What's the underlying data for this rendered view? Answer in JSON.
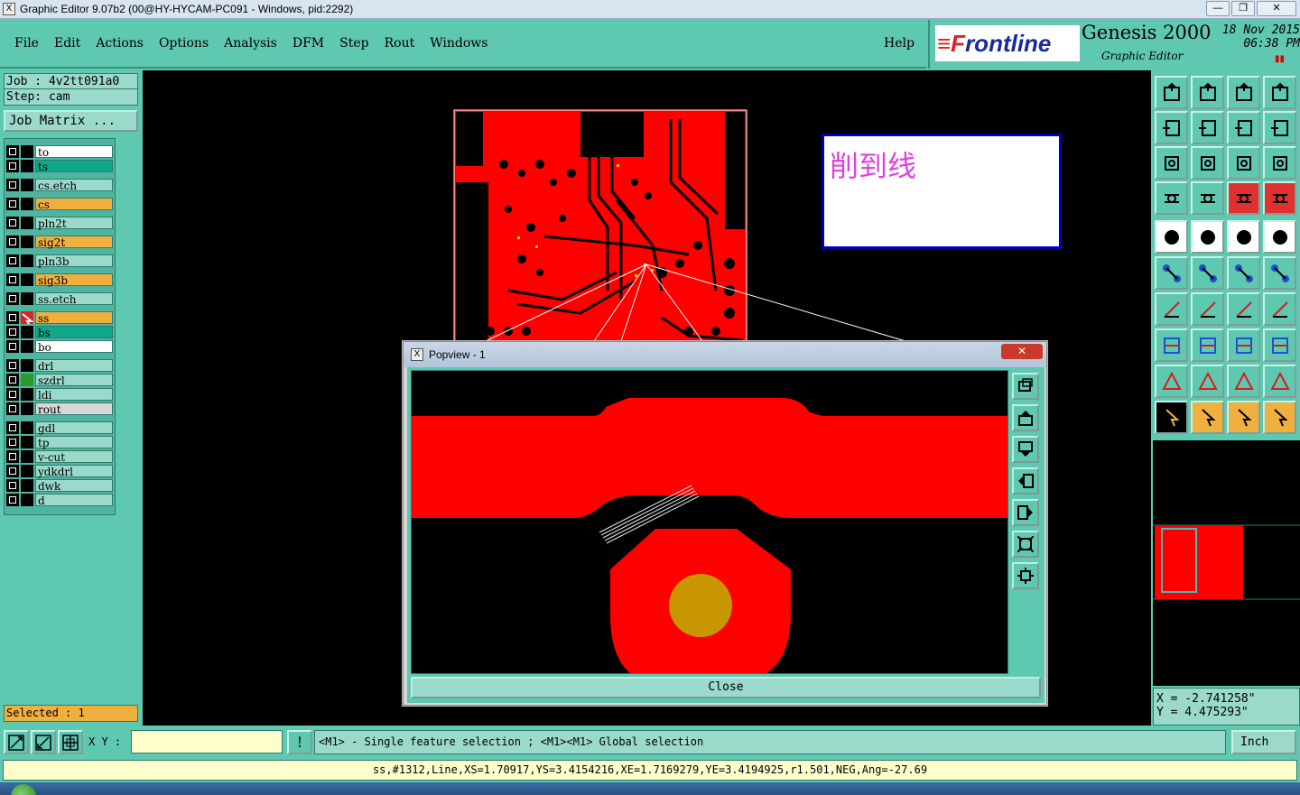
{
  "window": {
    "title": "Graphic Editor 9.07b2 (00@HY-HYCAM-PC091 - Windows, pid:2292)",
    "app_icon": "X",
    "buttons": [
      "—",
      "❐",
      "✕"
    ]
  },
  "menubar": {
    "items": [
      "File",
      "Edit",
      "Actions",
      "Options",
      "Analysis",
      "DFM",
      "Step",
      "Rout",
      "Windows"
    ],
    "help": "Help"
  },
  "brand": {
    "logo_mark": "≡F",
    "logo_text": "rontline",
    "product": "Genesis 2000",
    "subtitle": "Graphic Editor",
    "date": "18 Nov 2015",
    "time": "06:38 PM",
    "pause": "▮▮"
  },
  "job": {
    "job_line": "Job : 4v2tt091a0",
    "step_line": "Step: cam",
    "matrix_button": "Job Matrix ..."
  },
  "layers": [
    {
      "name": "to",
      "color": "#ffffff"
    },
    {
      "name": "ts",
      "color": "#0fa88a"
    },
    {
      "name": "cs.etch",
      "color": "#9bd9cb"
    },
    {
      "name": "cs",
      "color": "#f0b040"
    },
    {
      "name": "pln2t",
      "color": "#9bd9cb"
    },
    {
      "name": "sig2t",
      "color": "#f0b040"
    },
    {
      "name": "pln3b",
      "color": "#9bd9cb"
    },
    {
      "name": "sig3b",
      "color": "#f0b040"
    },
    {
      "name": "ss.etch",
      "color": "#9bd9cb"
    },
    {
      "name": "ss",
      "color": "#f0b040"
    },
    {
      "name": "bs",
      "color": "#0fa88a"
    },
    {
      "name": "bo",
      "color": "#ffffff"
    },
    {
      "name": "drl",
      "color": "#9bd9cb"
    },
    {
      "name": "szdrl",
      "color": "#9bd9cb"
    },
    {
      "name": "ldi",
      "color": "#9bd9cb"
    },
    {
      "name": "rout",
      "color": "#d8d8d8"
    },
    {
      "name": "gdl",
      "color": "#9bd9cb"
    },
    {
      "name": "tp",
      "color": "#9bd9cb"
    },
    {
      "name": "v-cut",
      "color": "#9bd9cb"
    },
    {
      "name": "ydkdrl",
      "color": "#9bd9cb"
    },
    {
      "name": "dwk",
      "color": "#9bd9cb"
    },
    {
      "name": "d",
      "color": "#9bd9cb"
    }
  ],
  "selected": "Selected : 1",
  "note": {
    "text": "削到线"
  },
  "popview": {
    "title": "Popview - 1",
    "close_x": "✕",
    "close_button": "Close"
  },
  "coords": {
    "x": "X = -2.741258\"",
    "y": "Y = 4.475293\""
  },
  "bottom": {
    "xy_label": "X Y :",
    "xy_value": "",
    "hint": "<M1> - Single feature selection ; <M1><M1> Global selection",
    "unit": "Inch",
    "info_button": "!"
  },
  "status": "ss,#1312,Line,XS=1.70917,YS=3.4154216,XE=1.7169279,YE=3.4194925,r1.501,NEG,Ang=-27.69"
}
